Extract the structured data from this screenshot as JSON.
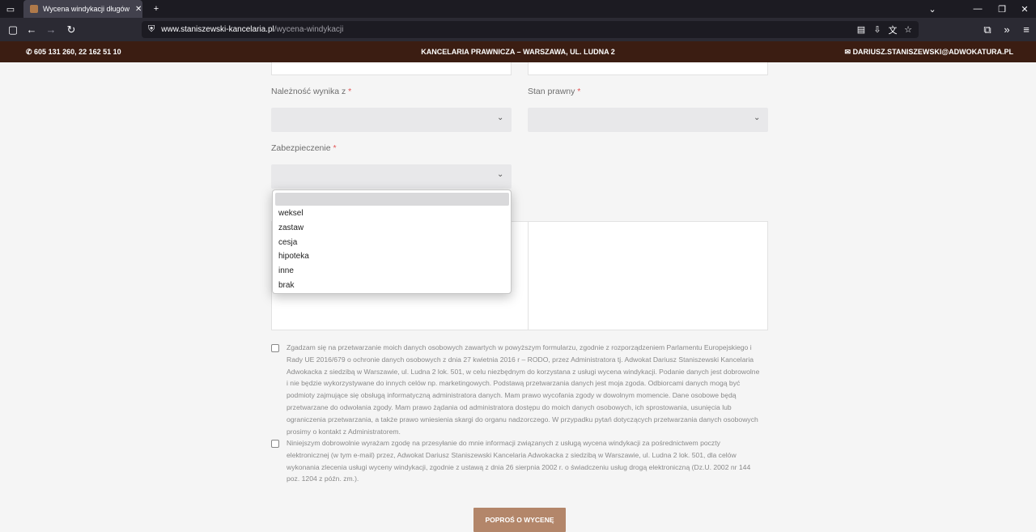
{
  "browser": {
    "tab_title": "Wycena windykacji długów prz",
    "url_host": "www.staniszewski-kancelaria.pl",
    "url_path": "/wycena-windykacji"
  },
  "header": {
    "phone": "605 131 260, 22 162 51 10",
    "center": "KANCELARIA PRAWNICZA – WARSZAWA, UL. LUDNA 2",
    "email": "DARIUSZ.STANISZEWSKI@ADWOKATURA.PL"
  },
  "form": {
    "naleznosc_label": "Należność wynika z",
    "stan_label": "Stan prawny",
    "zabezpieczenie_label": "Zabezpieczenie",
    "required_mark": "*",
    "zabezpieczenie_options": [
      "weksel",
      "zastaw",
      "cesja",
      "hipoteka",
      "inne",
      "brak"
    ],
    "consent1": "Zgadzam się na przetwarzanie moich danych osobowych zawartych w powyższym formularzu, zgodnie z rozporządzeniem Parlamentu Europejskiego i Rady UE 2016/679 o ochronie danych osobowych z dnia 27 kwietnia 2016 r – RODO, przez Administratora tj. Adwokat Dariusz Staniszewski Kancelaria Adwokacka z siedzibą w Warszawie, ul. Ludna 2 lok. 501, w celu niezbędnym do korzystana z usługi wycena windykacji. Podanie danych jest dobrowolne i nie będzie wykorzystywane do innych celów np. marketingowych. Podstawą przetwarzania danych jest moja zgoda. Odbiorcami danych mogą być podmioty zajmujące się obsługą informatyczną administratora danych. Mam prawo wycofania zgody w dowolnym momencie. Dane osobowe będą przetwarzane do odwołania zgody. Mam prawo żądania od administratora dostępu do moich danych osobowych, ich sprostowania, usunięcia lub ograniczenia przetwarzania, a także prawo wniesienia skargi do organu nadzorczego. W przypadku pytań dotyczących przetwarzania danych osobowych prosimy o kontakt z Administratorem.",
    "consent2": "Niniejszym dobrowolnie wyrażam zgodę na przesyłanie do mnie informacji związanych z usługą wycena windykacji za pośrednictwem poczty elektronicznej (w tym e-mail) przez, Adwokat Dariusz Staniszewski Kancelaria Adwokacka z siedzibą w Warszawie, ul. Ludna 2 lok. 501, dla celów wykonania zlecenia usługi wyceny windykacji, zgodnie z ustawą z dnia 26 sierpnia 2002 r. o świadczeniu usług drogą elektroniczną (Dz.U. 2002 nr 144 poz. 1204 z późn. zm.).",
    "submit_label": "POPROŚ O WYCENĘ"
  }
}
